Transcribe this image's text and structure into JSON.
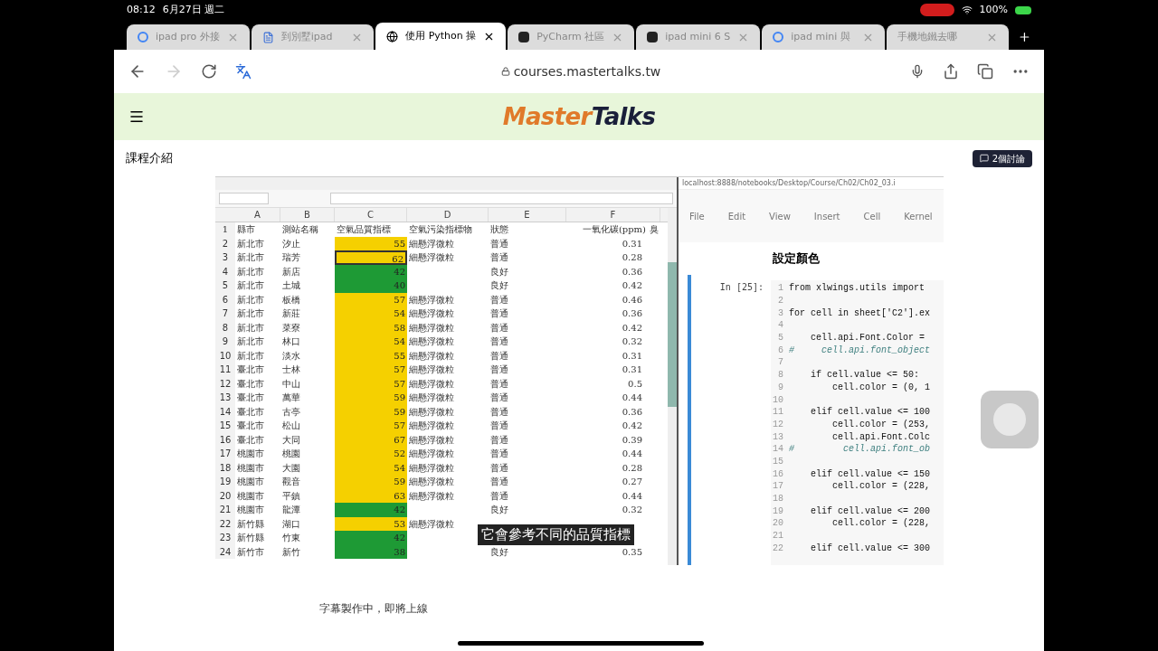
{
  "status_bar": {
    "time": "08:12",
    "date": "6月27日 週二",
    "battery": "100%"
  },
  "tabs": [
    {
      "title": "ipad pro 外接",
      "selected": false,
      "kind": "google"
    },
    {
      "title": "到別墅ipad",
      "selected": false,
      "kind": "doc"
    },
    {
      "title": "使用 Python 操",
      "selected": true,
      "kind": "globe"
    },
    {
      "title": "PyCharm 社區",
      "selected": false,
      "kind": "app"
    },
    {
      "title": "ipad mini 6 S",
      "selected": false,
      "kind": "app"
    },
    {
      "title": "ipad mini 與",
      "selected": false,
      "kind": "google"
    },
    {
      "title": "手機地鐵去哪",
      "selected": false,
      "kind": "none"
    }
  ],
  "address": "courses.mastertalks.tw",
  "site": {
    "logo_a": "Master",
    "logo_b": "Talks",
    "section": "課程介紹",
    "discuss": "2個討論"
  },
  "sheet": {
    "columns": [
      "A",
      "B",
      "C",
      "D",
      "E",
      "F"
    ],
    "header": {
      "num": "1",
      "cells": [
        "縣市",
        "測站名稱",
        "空氣品質指標",
        "空氣污染指標物",
        "狀態",
        "",
        "一氧化碳(ppm)",
        "臭"
      ]
    },
    "rows": [
      {
        "num": "2",
        "county": "新北市",
        "site": "汐止",
        "aqi": "55",
        "pollutant": "細懸浮微粒",
        "status": "普通",
        "co": "0.31",
        "color": "#f5d000",
        "selected": false
      },
      {
        "num": "3",
        "county": "新北市",
        "site": "瑞芳",
        "aqi": "62",
        "pollutant": "細懸浮微粒",
        "status": "普通",
        "co": "0.28",
        "color": "#f5d000",
        "selected": true
      },
      {
        "num": "4",
        "county": "新北市",
        "site": "新店",
        "aqi": "42",
        "pollutant": "",
        "status": "良好",
        "co": "0.36",
        "color": "#1e9a35",
        "selected": false
      },
      {
        "num": "5",
        "county": "新北市",
        "site": "土城",
        "aqi": "40",
        "pollutant": "",
        "status": "良好",
        "co": "0.42",
        "color": "#1e9a35",
        "selected": false
      },
      {
        "num": "6",
        "county": "新北市",
        "site": "板橋",
        "aqi": "57",
        "pollutant": "細懸浮微粒",
        "status": "普通",
        "co": "0.46",
        "color": "#f5d000",
        "selected": false
      },
      {
        "num": "7",
        "county": "新北市",
        "site": "新莊",
        "aqi": "54",
        "pollutant": "細懸浮微粒",
        "status": "普通",
        "co": "0.36",
        "color": "#f5d000",
        "selected": false
      },
      {
        "num": "8",
        "county": "新北市",
        "site": "菜寮",
        "aqi": "58",
        "pollutant": "細懸浮微粒",
        "status": "普通",
        "co": "0.42",
        "color": "#f5d000",
        "selected": false
      },
      {
        "num": "9",
        "county": "新北市",
        "site": "林口",
        "aqi": "54",
        "pollutant": "細懸浮微粒",
        "status": "普通",
        "co": "0.32",
        "color": "#f5d000",
        "selected": false
      },
      {
        "num": "10",
        "county": "新北市",
        "site": "淡水",
        "aqi": "55",
        "pollutant": "細懸浮微粒",
        "status": "普通",
        "co": "0.31",
        "color": "#f5d000",
        "selected": false
      },
      {
        "num": "11",
        "county": "臺北市",
        "site": "士林",
        "aqi": "57",
        "pollutant": "細懸浮微粒",
        "status": "普通",
        "co": "0.31",
        "color": "#f5d000",
        "selected": false
      },
      {
        "num": "12",
        "county": "臺北市",
        "site": "中山",
        "aqi": "57",
        "pollutant": "細懸浮微粒",
        "status": "普通",
        "co": "0.5",
        "color": "#f5d000",
        "selected": false
      },
      {
        "num": "13",
        "county": "臺北市",
        "site": "萬華",
        "aqi": "59",
        "pollutant": "細懸浮微粒",
        "status": "普通",
        "co": "0.44",
        "color": "#f5d000",
        "selected": false
      },
      {
        "num": "14",
        "county": "臺北市",
        "site": "古亭",
        "aqi": "59",
        "pollutant": "細懸浮微粒",
        "status": "普通",
        "co": "0.36",
        "color": "#f5d000",
        "selected": false
      },
      {
        "num": "15",
        "county": "臺北市",
        "site": "松山",
        "aqi": "57",
        "pollutant": "細懸浮微粒",
        "status": "普通",
        "co": "0.42",
        "color": "#f5d000",
        "selected": false
      },
      {
        "num": "16",
        "county": "臺北市",
        "site": "大同",
        "aqi": "67",
        "pollutant": "細懸浮微粒",
        "status": "普通",
        "co": "0.39",
        "color": "#f5d000",
        "selected": false
      },
      {
        "num": "17",
        "county": "桃園市",
        "site": "桃園",
        "aqi": "52",
        "pollutant": "細懸浮微粒",
        "status": "普通",
        "co": "0.44",
        "color": "#f5d000",
        "selected": false
      },
      {
        "num": "18",
        "county": "桃園市",
        "site": "大園",
        "aqi": "54",
        "pollutant": "細懸浮微粒",
        "status": "普通",
        "co": "0.28",
        "color": "#f5d000",
        "selected": false
      },
      {
        "num": "19",
        "county": "桃園市",
        "site": "觀音",
        "aqi": "59",
        "pollutant": "細懸浮微粒",
        "status": "普通",
        "co": "0.27",
        "color": "#f5d000",
        "selected": false
      },
      {
        "num": "20",
        "county": "桃園市",
        "site": "平鎮",
        "aqi": "63",
        "pollutant": "細懸浮微粒",
        "status": "普通",
        "co": "0.44",
        "color": "#f5d000",
        "selected": false
      },
      {
        "num": "21",
        "county": "桃園市",
        "site": "龍潭",
        "aqi": "42",
        "pollutant": "",
        "status": "良好",
        "co": "0.32",
        "color": "#1e9a35",
        "selected": false
      },
      {
        "num": "22",
        "county": "新竹縣",
        "site": "湖口",
        "aqi": "53",
        "pollutant": "細懸浮微粒",
        "status": "",
        "co": "",
        "color": "#f5d000",
        "selected": false
      },
      {
        "num": "23",
        "county": "新竹縣",
        "site": "竹東",
        "aqi": "42",
        "pollutant": "",
        "status": "",
        "co": "",
        "color": "#1e9a35",
        "selected": false
      },
      {
        "num": "24",
        "county": "新竹市",
        "site": "新竹",
        "aqi": "38",
        "pollutant": "",
        "status": "良好",
        "co": "0.35",
        "color": "#1e9a35",
        "selected": false
      }
    ],
    "caption": "它會參考不同的品質指標"
  },
  "notebook": {
    "url": "localhost:8888/notebooks/Desktop/Course/Ch02/Ch02_03.i",
    "menu": [
      "File",
      "Edit",
      "View",
      "Insert",
      "Cell",
      "Kernel"
    ],
    "heading": "設定顏色",
    "prompt": "In [25]:",
    "lines": [
      {
        "num": "1",
        "text": "from xlwings.utils import",
        "kind": "code"
      },
      {
        "num": "2"
      },
      {
        "num": "3",
        "text": "for cell in sheet['C2'].ex",
        "kind": "code"
      },
      {
        "num": "4"
      },
      {
        "num": "5",
        "text": "    cell.api.Font.Color =",
        "kind": "code"
      },
      {
        "num": "6",
        "text": "#     cell.api.font_object",
        "kind": "comment"
      },
      {
        "num": "7"
      },
      {
        "num": "8",
        "text": "    if cell.value <= 50:",
        "kind": "code"
      },
      {
        "num": "9",
        "text": "        cell.color = (0, 1",
        "kind": "code"
      },
      {
        "num": "10"
      },
      {
        "num": "11",
        "text": "    elif cell.value <= 100",
        "kind": "code"
      },
      {
        "num": "12",
        "text": "        cell.color = (253,",
        "kind": "code"
      },
      {
        "num": "13",
        "text": "        cell.api.Font.Colc",
        "kind": "code"
      },
      {
        "num": "14",
        "text": "#         cell.api.font_ob",
        "kind": "comment"
      },
      {
        "num": "15"
      },
      {
        "num": "16",
        "text": "    elif cell.value <= 150",
        "kind": "code"
      },
      {
        "num": "17",
        "text": "        cell.color = (228,",
        "kind": "code"
      },
      {
        "num": "18"
      },
      {
        "num": "19",
        "text": "    elif cell.value <= 200",
        "kind": "code"
      },
      {
        "num": "20",
        "text": "        cell.color = (228,",
        "kind": "code"
      },
      {
        "num": "21"
      },
      {
        "num": "22",
        "text": "    elif cell.value <= 300",
        "kind": "code"
      }
    ]
  },
  "subtitle_note": "字幕製作中，即將上線"
}
